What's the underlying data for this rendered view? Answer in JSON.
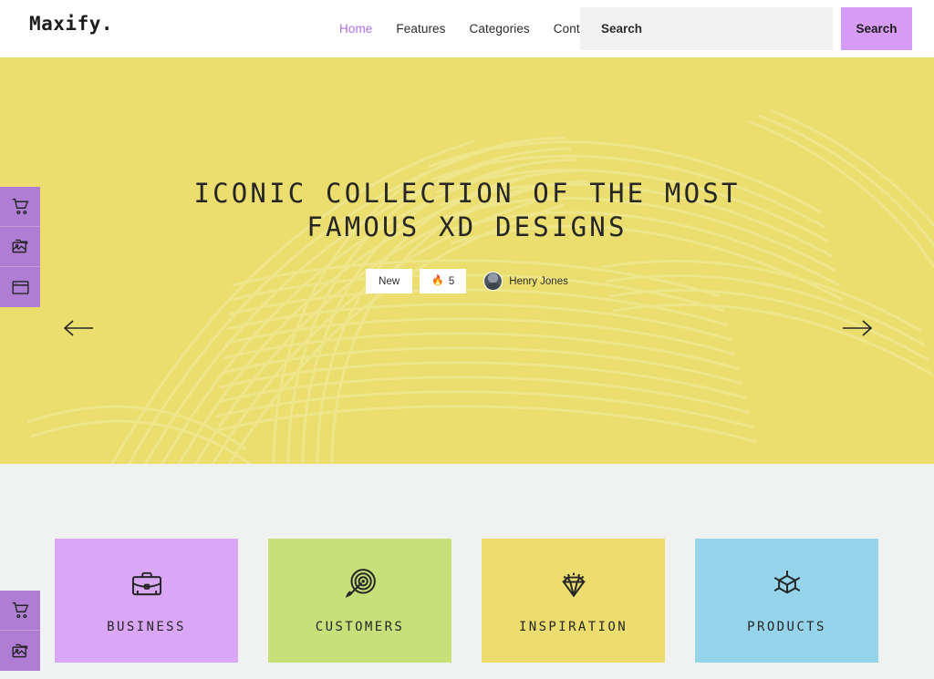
{
  "header": {
    "logo": "Maxify.",
    "nav": [
      {
        "label": "Home",
        "active": true
      },
      {
        "label": "Features",
        "active": false
      },
      {
        "label": "Categories",
        "active": false
      },
      {
        "label": "Contacts",
        "active": false
      }
    ],
    "search": {
      "placeholder": "Search",
      "value": "",
      "button_label": "Search"
    }
  },
  "hero": {
    "title_line1": "ICONIC COLLECTION OF THE MOST",
    "title_line2": "FAMOUS XD DESIGNS",
    "badge_new": "New",
    "fire_icon": "fire-icon",
    "fire_count": "5",
    "author_name": "Henry Jones",
    "prev_label": "prev-slide-arrow",
    "next_label": "next-slide-arrow",
    "background_color": "#ebdd6e",
    "stripe_color": "#f4eca4"
  },
  "side_dock_top": [
    {
      "icon": "shopping-cart-icon"
    },
    {
      "icon": "image-folder-icon"
    },
    {
      "icon": "browser-window-icon"
    }
  ],
  "side_dock_bottom": [
    {
      "icon": "shopping-cart-icon"
    },
    {
      "icon": "image-folder-icon"
    }
  ],
  "dock_color": "#b07dd4",
  "cards": [
    {
      "label": "BUSINESS",
      "icon": "briefcase-icon",
      "color": "#d9a7f5"
    },
    {
      "label": "CUSTOMERS",
      "icon": "target-icon",
      "color": "#c6e07a"
    },
    {
      "label": "INSPIRATION",
      "icon": "diamond-icon",
      "color": "#ecdd6e"
    },
    {
      "label": "PRODUCTS",
      "icon": "cube-icon",
      "color": "#95d4ea"
    }
  ],
  "section_background": "#f0f1f1"
}
